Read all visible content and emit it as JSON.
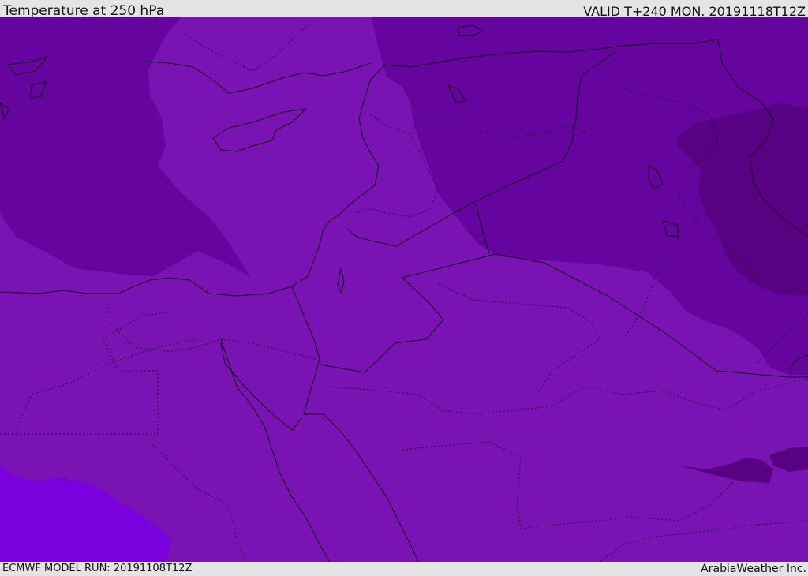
{
  "header": {
    "title": "Temperature at 250 hPa",
    "valid_time": "VALID T+240 MON. 20191118T12Z"
  },
  "footer": {
    "model_run": "ECMWF MODEL RUN: 20191108T12Z",
    "credit": "ArabiaWeather Inc."
  },
  "map": {
    "colors": {
      "band_base": "#7a13b3",
      "band_cool": "#65049f",
      "band_cold": "#560282",
      "band_warm": "#7a00dd",
      "border_line": "#111111"
    }
  }
}
